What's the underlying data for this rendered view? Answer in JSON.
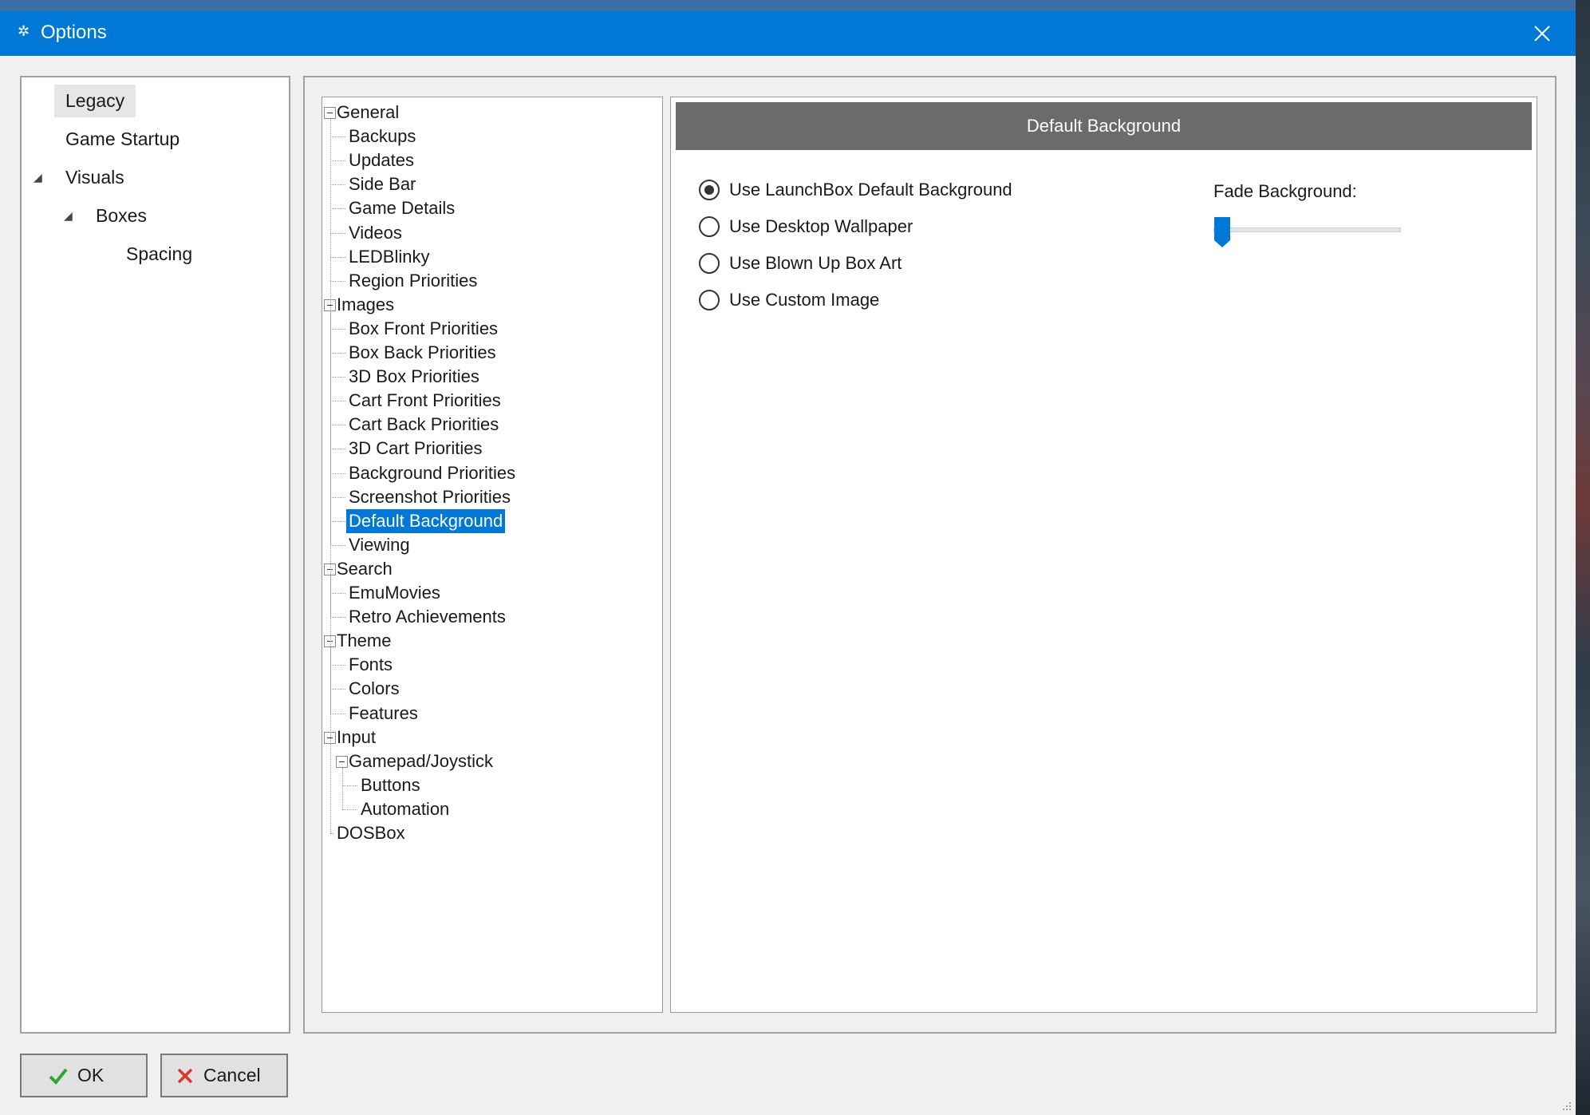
{
  "window": {
    "title": "Options",
    "app_icon": "gear-icon",
    "close_icon": "close-icon"
  },
  "categories": [
    {
      "label": "Legacy",
      "selected": true
    },
    {
      "label": "Game Startup"
    },
    {
      "label": "Visuals",
      "expanded": true
    },
    {
      "label": "Boxes",
      "expanded": true
    },
    {
      "label": "Spacing"
    }
  ],
  "tree": [
    {
      "label": "General",
      "level": 0,
      "expanded": true
    },
    {
      "label": "Backups",
      "level": 1
    },
    {
      "label": "Updates",
      "level": 1
    },
    {
      "label": "Side Bar",
      "level": 1
    },
    {
      "label": "Game Details",
      "level": 1
    },
    {
      "label": "Videos",
      "level": 1
    },
    {
      "label": "LEDBlinky",
      "level": 1
    },
    {
      "label": "Region Priorities",
      "level": 1
    },
    {
      "label": "Images",
      "level": 0,
      "expanded": true
    },
    {
      "label": "Box Front Priorities",
      "level": 1
    },
    {
      "label": "Box Back Priorities",
      "level": 1
    },
    {
      "label": "3D Box Priorities",
      "level": 1
    },
    {
      "label": "Cart Front Priorities",
      "level": 1
    },
    {
      "label": "Cart Back Priorities",
      "level": 1
    },
    {
      "label": "3D Cart Priorities",
      "level": 1
    },
    {
      "label": "Background Priorities",
      "level": 1
    },
    {
      "label": "Screenshot Priorities",
      "level": 1
    },
    {
      "label": "Default Background",
      "level": 1,
      "selected": true
    },
    {
      "label": "Viewing",
      "level": 1
    },
    {
      "label": "Search",
      "level": 0,
      "expanded": true
    },
    {
      "label": "EmuMovies",
      "level": 1
    },
    {
      "label": "Retro Achievements",
      "level": 1
    },
    {
      "label": "Theme",
      "level": 0,
      "expanded": true
    },
    {
      "label": "Fonts",
      "level": 1
    },
    {
      "label": "Colors",
      "level": 1
    },
    {
      "label": "Features",
      "level": 1
    },
    {
      "label": "Input",
      "level": 0,
      "expanded": true
    },
    {
      "label": "Gamepad/Joystick",
      "level": 1,
      "expanded": true
    },
    {
      "label": "Buttons",
      "level": 2
    },
    {
      "label": "Automation",
      "level": 2
    },
    {
      "label": "DOSBox",
      "level": 0
    }
  ],
  "content": {
    "header": "Default Background",
    "options": [
      {
        "label": "Use LaunchBox Default Background",
        "checked": true
      },
      {
        "label": "Use Desktop Wallpaper",
        "checked": false
      },
      {
        "label": "Use Blown Up Box Art",
        "checked": false
      },
      {
        "label": "Use Custom Image",
        "checked": false
      }
    ],
    "fade_label": "Fade Background:",
    "fade_value": 0
  },
  "buttons": {
    "ok_label": "OK",
    "ok_icon": "checkmark-icon",
    "ok_color": "#2aa832",
    "cancel_label": "Cancel",
    "cancel_icon": "x-icon",
    "cancel_color": "#e0342a"
  },
  "colors": {
    "titlebar": "#0078d7",
    "selection": "#0078d7",
    "header": "#6b6b6b"
  }
}
